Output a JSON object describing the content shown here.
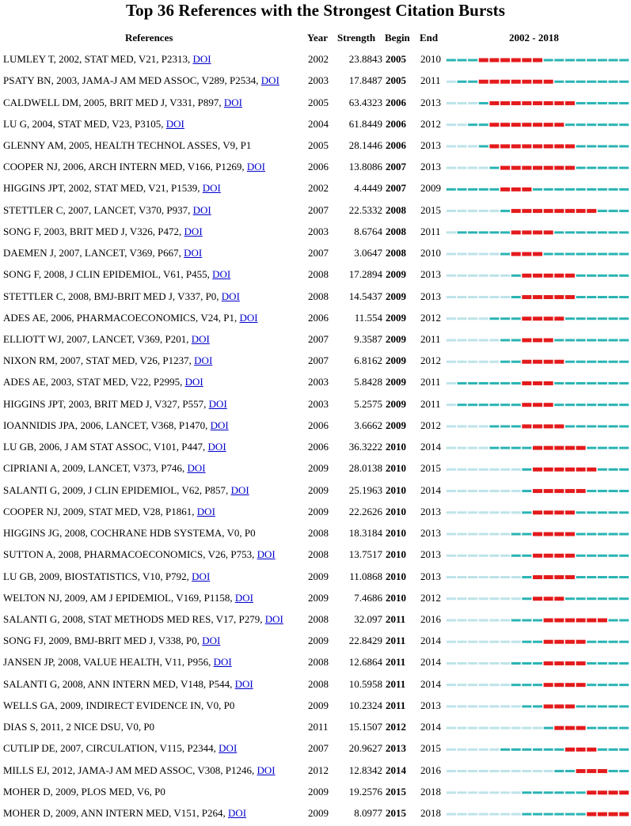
{
  "title": "Top 36 References with the Strongest Citation Bursts",
  "headers": {
    "references": "References",
    "year": "Year",
    "strength": "Strength",
    "begin": "Begin",
    "end": "End",
    "range": "2002 - 2018"
  },
  "colors": {
    "burst": "#e41a1c",
    "active": "#2ab3b3",
    "inactive": "#bde3e9",
    "link": "#0000cc"
  },
  "chart_data": {
    "type": "table",
    "title": "Top 36 References with the Strongest Citation Bursts",
    "timeline_start": 2002,
    "timeline_end": 2018,
    "columns": [
      "References",
      "Year",
      "Strength",
      "Begin",
      "End",
      "2002 - 2018"
    ],
    "rows": [
      {
        "ref": "LUMLEY T, 2002, STAT MED, V21, P2313, ",
        "doi": "DOI",
        "year": "2002",
        "strength": "23.8843",
        "begin": "2005",
        "end": "2010"
      },
      {
        "ref": "PSATY BN, 2003, JAMA-J AM MED ASSOC, V289, P2534, ",
        "doi": "DOI",
        "year": "2003",
        "strength": "17.8487",
        "begin": "2005",
        "end": "2011"
      },
      {
        "ref": "CALDWELL DM, 2005, BRIT MED J, V331, P897, ",
        "doi": "DOI",
        "year": "2005",
        "strength": "63.4323",
        "begin": "2006",
        "end": "2013"
      },
      {
        "ref": "LU G, 2004, STAT MED, V23, P3105, ",
        "doi": "DOI",
        "year": "2004",
        "strength": "61.8449",
        "begin": "2006",
        "end": "2012"
      },
      {
        "ref": "GLENNY AM, 2005, HEALTH TECHNOL ASSES, V9, P1",
        "doi": "",
        "year": "2005",
        "strength": "28.1446",
        "begin": "2006",
        "end": "2013"
      },
      {
        "ref": "COOPER NJ, 2006, ARCH INTERN MED, V166, P1269, ",
        "doi": "DOI",
        "year": "2006",
        "strength": "13.8086",
        "begin": "2007",
        "end": "2013"
      },
      {
        "ref": "HIGGINS JPT, 2002, STAT MED, V21, P1539, ",
        "doi": "DOI",
        "year": "2002",
        "strength": "4.4449",
        "begin": "2007",
        "end": "2009"
      },
      {
        "ref": "STETTLER C, 2007, LANCET, V370, P937, ",
        "doi": "DOI",
        "year": "2007",
        "strength": "22.5332",
        "begin": "2008",
        "end": "2015"
      },
      {
        "ref": "SONG F, 2003, BRIT MED J, V326, P472, ",
        "doi": "DOI",
        "year": "2003",
        "strength": "8.6764",
        "begin": "2008",
        "end": "2011"
      },
      {
        "ref": "DAEMEN J, 2007, LANCET, V369, P667, ",
        "doi": "DOI",
        "year": "2007",
        "strength": "3.0647",
        "begin": "2008",
        "end": "2010"
      },
      {
        "ref": "SONG F, 2008, J CLIN EPIDEMIOL, V61, P455, ",
        "doi": "DOI",
        "year": "2008",
        "strength": "17.2894",
        "begin": "2009",
        "end": "2013"
      },
      {
        "ref": "STETTLER C, 2008, BMJ-BRIT MED J, V337, P0, ",
        "doi": "DOI",
        "year": "2008",
        "strength": "14.5437",
        "begin": "2009",
        "end": "2013"
      },
      {
        "ref": "ADES AE, 2006, PHARMACOECONOMICS, V24, P1, ",
        "doi": "DOI",
        "year": "2006",
        "strength": "11.554",
        "begin": "2009",
        "end": "2012"
      },
      {
        "ref": "ELLIOTT WJ, 2007, LANCET, V369, P201, ",
        "doi": "DOI",
        "year": "2007",
        "strength": "9.3587",
        "begin": "2009",
        "end": "2011"
      },
      {
        "ref": "NIXON RM, 2007, STAT MED, V26, P1237, ",
        "doi": "DOI",
        "year": "2007",
        "strength": "6.8162",
        "begin": "2009",
        "end": "2012"
      },
      {
        "ref": "ADES AE, 2003, STAT MED, V22, P2995, ",
        "doi": "DOI",
        "year": "2003",
        "strength": "5.8428",
        "begin": "2009",
        "end": "2011"
      },
      {
        "ref": "HIGGINS JPT, 2003, BRIT MED J, V327, P557, ",
        "doi": "DOI",
        "year": "2003",
        "strength": "5.2575",
        "begin": "2009",
        "end": "2011"
      },
      {
        "ref": "IOANNIDIS JPA, 2006, LANCET, V368, P1470, ",
        "doi": "DOI",
        "year": "2006",
        "strength": "3.6662",
        "begin": "2009",
        "end": "2012"
      },
      {
        "ref": "LU GB, 2006, J AM STAT ASSOC, V101, P447, ",
        "doi": "DOI",
        "year": "2006",
        "strength": "36.3222",
        "begin": "2010",
        "end": "2014"
      },
      {
        "ref": "CIPRIANI A, 2009, LANCET, V373, P746, ",
        "doi": "DOI",
        "year": "2009",
        "strength": "28.0138",
        "begin": "2010",
        "end": "2015"
      },
      {
        "ref": "SALANTI G, 2009, J CLIN EPIDEMIOL, V62, P857, ",
        "doi": "DOI",
        "year": "2009",
        "strength": "25.1963",
        "begin": "2010",
        "end": "2014"
      },
      {
        "ref": "COOPER NJ, 2009, STAT MED, V28, P1861, ",
        "doi": "DOI",
        "year": "2009",
        "strength": "22.2626",
        "begin": "2010",
        "end": "2013"
      },
      {
        "ref": "HIGGINS JG, 2008, COCHRANE HDB SYSTEMA, V0, P0",
        "doi": "",
        "year": "2008",
        "strength": "18.3184",
        "begin": "2010",
        "end": "2013"
      },
      {
        "ref": "SUTTON A, 2008, PHARMACOECONOMICS, V26, P753, ",
        "doi": "DOI",
        "year": "2008",
        "strength": "13.7517",
        "begin": "2010",
        "end": "2013"
      },
      {
        "ref": "LU GB, 2009, BIOSTATISTICS, V10, P792, ",
        "doi": "DOI",
        "year": "2009",
        "strength": "11.0868",
        "begin": "2010",
        "end": "2013"
      },
      {
        "ref": "WELTON NJ, 2009, AM J EPIDEMIOL, V169, P1158, ",
        "doi": "DOI",
        "year": "2009",
        "strength": "7.4686",
        "begin": "2010",
        "end": "2012"
      },
      {
        "ref": "SALANTI G, 2008, STAT METHODS MED RES, V17, P279, ",
        "doi": "DOI",
        "year": "2008",
        "strength": "32.097",
        "begin": "2011",
        "end": "2016"
      },
      {
        "ref": "SONG FJ, 2009, BMJ-BRIT MED J, V338, P0, ",
        "doi": "DOI",
        "year": "2009",
        "strength": "22.8429",
        "begin": "2011",
        "end": "2014"
      },
      {
        "ref": "JANSEN JP, 2008, VALUE HEALTH, V11, P956, ",
        "doi": "DOI",
        "year": "2008",
        "strength": "12.6864",
        "begin": "2011",
        "end": "2014"
      },
      {
        "ref": "SALANTI G, 2008, ANN INTERN MED, V148, P544, ",
        "doi": "DOI",
        "year": "2008",
        "strength": "10.5958",
        "begin": "2011",
        "end": "2014"
      },
      {
        "ref": "WELLS GA, 2009, INDIRECT EVIDENCE IN, V0, P0",
        "doi": "",
        "year": "2009",
        "strength": "10.2324",
        "begin": "2011",
        "end": "2013"
      },
      {
        "ref": "DIAS S, 2011, 2 NICE DSU, V0, P0",
        "doi": "",
        "year": "2011",
        "strength": "15.1507",
        "begin": "2012",
        "end": "2014"
      },
      {
        "ref": "CUTLIP DE, 2007, CIRCULATION, V115, P2344, ",
        "doi": "DOI",
        "year": "2007",
        "strength": "20.9627",
        "begin": "2013",
        "end": "2015"
      },
      {
        "ref": "MILLS EJ, 2012, JAMA-J AM MED ASSOC, V308, P1246, ",
        "doi": "DOI",
        "year": "2012",
        "strength": "12.8342",
        "begin": "2014",
        "end": "2016"
      },
      {
        "ref": "MOHER D, 2009, PLOS MED, V6, P0",
        "doi": "",
        "year": "2009",
        "strength": "19.2576",
        "begin": "2015",
        "end": "2018"
      },
      {
        "ref": "MOHER D, 2009, ANN INTERN MED, V151, P264, ",
        "doi": "DOI",
        "year": "2009",
        "strength": "8.0977",
        "begin": "2015",
        "end": "2018"
      }
    ]
  }
}
